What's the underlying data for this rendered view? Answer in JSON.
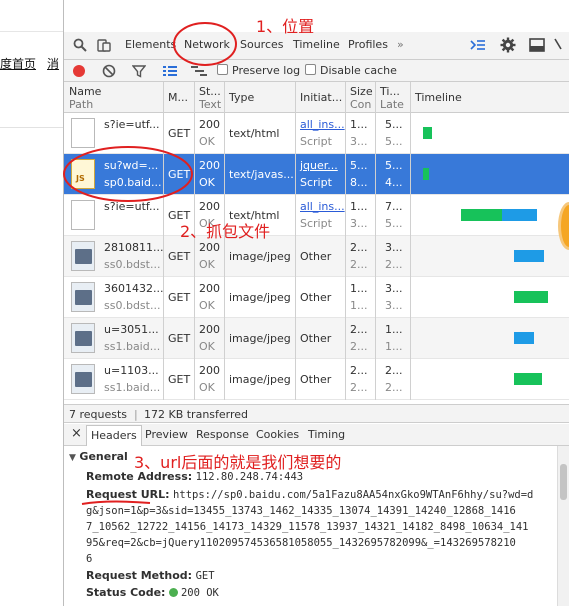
{
  "page_fragment": {
    "nav_links": [
      "度首页",
      "消"
    ]
  },
  "devtools": {
    "tabs": [
      "Elements",
      "Network",
      "Sources",
      "Timeline",
      "Profiles"
    ],
    "more_tabs": "»",
    "active_tab": "Network",
    "toolbar": {
      "preserve_log": "Preserve log",
      "disable_cache": "Disable cache"
    },
    "columns": {
      "name": [
        "Name",
        "Path"
      ],
      "method": [
        "M..."
      ],
      "status": [
        "St...",
        "Text"
      ],
      "type": [
        "Type"
      ],
      "initiator": [
        "Initiat..."
      ],
      "size": [
        "Size",
        "Con"
      ],
      "time": [
        "Ti...",
        "Late"
      ],
      "timeline": [
        "Timeline"
      ]
    },
    "rows": [
      {
        "name1": "s?ie=utf...",
        "name2": "",
        "method": "GET",
        "status1": "200",
        "status2": "OK",
        "type": "text/html",
        "init1": "all_ins...",
        "init2": "Script",
        "size1": "1...",
        "size2": "3...",
        "time1": "5...",
        "time2": "5..."
      },
      {
        "name1": "su?wd=...",
        "name2": "sp0.baid...",
        "method": "GET",
        "status1": "200",
        "status2": "OK",
        "type": "text/javas...",
        "init1": "jquer...",
        "init2": "Script",
        "size1": "5...",
        "size2": "8...",
        "time1": "5...",
        "time2": "4..."
      },
      {
        "name1": "s?ie=utf...",
        "name2": "",
        "method": "GET",
        "status1": "200",
        "status2": "OK",
        "type": "text/html",
        "init1": "all_ins...",
        "init2": "Script",
        "size1": "1...",
        "size2": "3...",
        "time1": "7...",
        "time2": "5..."
      },
      {
        "name1": "2810811...",
        "name2": "ss0.bdst...",
        "method": "GET",
        "status1": "200",
        "status2": "OK",
        "type": "image/jpeg",
        "init1": "Other",
        "init2": "",
        "size1": "2...",
        "size2": "2...",
        "time1": "3...",
        "time2": "2..."
      },
      {
        "name1": "3601432...",
        "name2": "ss0.bdst...",
        "method": "GET",
        "status1": "200",
        "status2": "OK",
        "type": "image/jpeg",
        "init1": "Other",
        "init2": "",
        "size1": "1...",
        "size2": "1...",
        "time1": "3...",
        "time2": "3..."
      },
      {
        "name1": "u=3051...",
        "name2": "ss1.baid...",
        "method": "GET",
        "status1": "200",
        "status2": "OK",
        "type": "image/jpeg",
        "init1": "Other",
        "init2": "",
        "size1": "2...",
        "size2": "2...",
        "time1": "1...",
        "time2": "1..."
      },
      {
        "name1": "u=1103...",
        "name2": "ss1.baid...",
        "method": "GET",
        "status1": "200",
        "status2": "OK",
        "type": "image/jpeg",
        "init1": "Other",
        "init2": "",
        "size1": "2...",
        "size2": "2...",
        "time1": "2...",
        "time2": "2..."
      }
    ],
    "summary": {
      "requests": "7 requests",
      "transferred": "172 KB transferred"
    },
    "detail_tabs": [
      "Headers",
      "Preview",
      "Response",
      "Cookies",
      "Timing"
    ],
    "detail_close": "×",
    "general": {
      "section_title": "General",
      "remote_address_key": "Remote Address:",
      "remote_address_val": "112.80.248.74:443",
      "request_url_key": "Request URL:",
      "request_url_lines": [
        "https://sp0.baidu.com/5a1Fazu8AA54nxGko9WTAnF6hhy/su?wd=d",
        "g&json=1&p=3&sid=13455_13743_1462_14335_13074_14391_14240_12868_1416",
        "7_10562_12722_14156_14173_14329_11578_13937_14321_14182_8498_10634_141",
        "95&req=2&cb=jQuery110209574536581058055_1432695782099&_=143269578210",
        "6"
      ],
      "request_method_key": "Request Method:",
      "request_method_val": "GET",
      "status_code_key": "Status Code:",
      "status_code_val": "200 OK"
    }
  },
  "annotations": {
    "a1": "1、位置",
    "a2": "2、抓包文件",
    "a3": "3、url后面的就是我们想要的"
  },
  "colors": {
    "selected_row": "#3879d9",
    "annotation": "#e02020",
    "wf_green": "#17c25a",
    "wf_blue": "#1e9be6"
  }
}
